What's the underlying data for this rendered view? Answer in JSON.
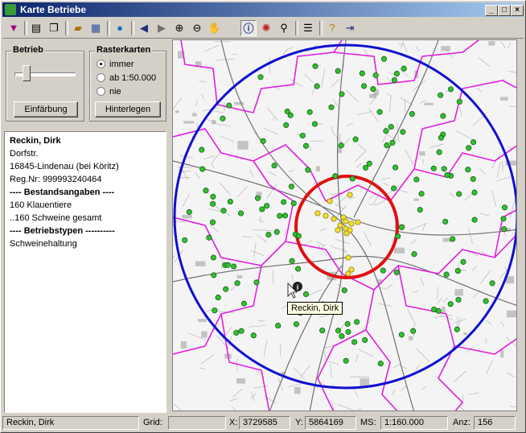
{
  "window": {
    "title": "Karte Betriebe"
  },
  "toolbar": {
    "icons": [
      "filter-icon",
      "print-icon",
      "copy-icon",
      "open-folder-icon",
      "grid-icon",
      "globe-icon",
      "back-icon",
      "forward-icon",
      "zoom-in-icon",
      "zoom-out-icon",
      "pan-hand-icon",
      "info-icon",
      "measure-icon",
      "find-icon",
      "list-icon",
      "help-icon",
      "exit-icon"
    ]
  },
  "betrieb": {
    "label": "Betrieb",
    "slider_fraction": 0.15,
    "button": "Einfärbung"
  },
  "rasterkarten": {
    "label": "Rasterkarten",
    "options": [
      "immer",
      "ab 1:50.000",
      "nie"
    ],
    "selected": "immer",
    "button": "Hinterlegen"
  },
  "details": {
    "name": "Reckin, Dirk",
    "street": "Dorfstr.",
    "city": "16845-Lindenau (bei Köritz)",
    "regnr": "Reg.Nr: 999993240464",
    "bestand_header": "---- Bestandsangaben ----",
    "klauen": "160 Klauentiere",
    "schweine": "..160 Schweine gesamt",
    "typen_header": "---- Betriebstypen ----------",
    "typ": "Schweinehaltung"
  },
  "map": {
    "tooltip": "Reckin, Dirk",
    "outer_circle_color": "#1010d0",
    "inner_circle_color": "#e01010",
    "boundary_color": "#e020e0",
    "farm_color": "#30c030",
    "highlight_color": "#f0e030"
  },
  "status": {
    "name": "Reckin, Dirk",
    "grid_label": "Grid:",
    "grid_value": "",
    "x_label": "X:",
    "x_value": "3729585",
    "y_label": "Y:",
    "y_value": "5864169",
    "ms_label": "MS:",
    "ms_value": "1:160.000",
    "anz_label": "Anz:",
    "anz_value": "156"
  }
}
